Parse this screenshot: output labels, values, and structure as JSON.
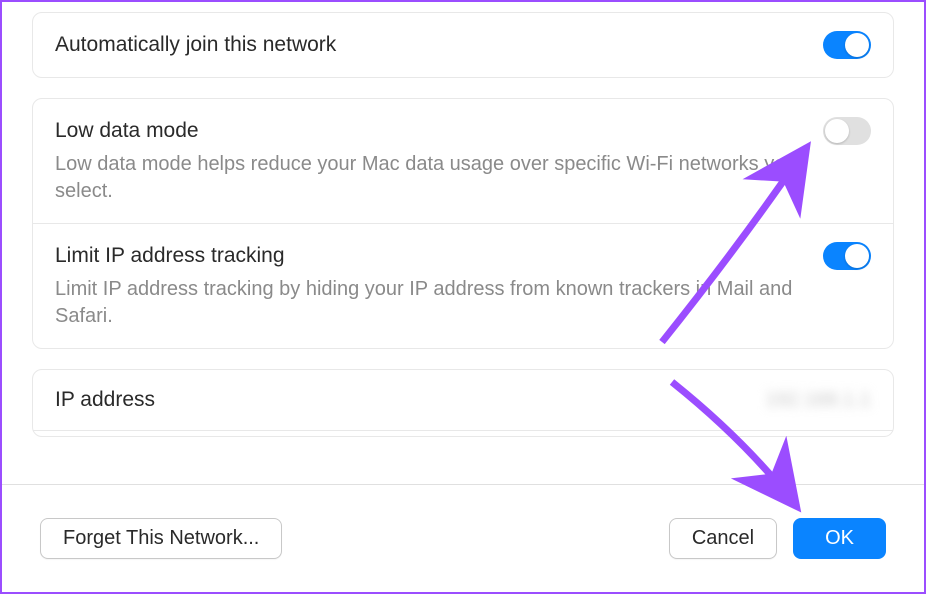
{
  "sections": {
    "auto_join": {
      "title": "Automatically join this network",
      "enabled": true
    },
    "low_data": {
      "title": "Low data mode",
      "description": "Low data mode helps reduce your Mac data usage over specific Wi-Fi networks you select.",
      "enabled": false
    },
    "limit_ip": {
      "title": "Limit IP address tracking",
      "description": "Limit IP address tracking by hiding your IP address from known trackers in Mail and Safari.",
      "enabled": true
    },
    "ip_address": {
      "title": "IP address",
      "value": "192.168.1.1"
    }
  },
  "footer": {
    "forget_label": "Forget This Network...",
    "cancel_label": "Cancel",
    "ok_label": "OK"
  },
  "colors": {
    "accent": "#0a84ff",
    "annotation": "#9b4dff"
  }
}
